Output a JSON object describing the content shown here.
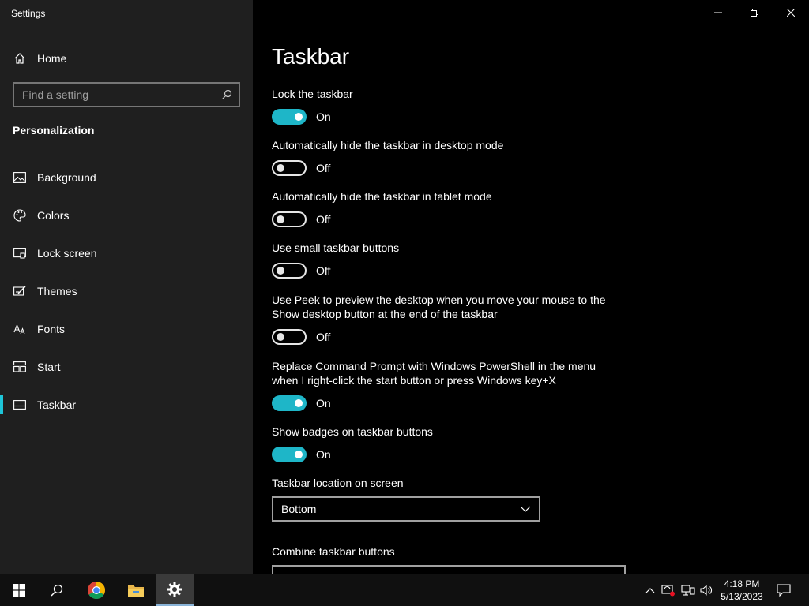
{
  "window": {
    "title": "Settings"
  },
  "sidebar": {
    "home_label": "Home",
    "search_placeholder": "Find a setting",
    "section_title": "Personalization",
    "items": [
      {
        "label": "Background",
        "icon": "picture-icon"
      },
      {
        "label": "Colors",
        "icon": "palette-icon"
      },
      {
        "label": "Lock screen",
        "icon": "lock-screen-icon"
      },
      {
        "label": "Themes",
        "icon": "themes-icon"
      },
      {
        "label": "Fonts",
        "icon": "fonts-icon"
      },
      {
        "label": "Start",
        "icon": "start-icon"
      },
      {
        "label": "Taskbar",
        "icon": "taskbar-icon",
        "active": true
      }
    ]
  },
  "main": {
    "title": "Taskbar",
    "settings": [
      {
        "label": "Lock the taskbar",
        "state": "On"
      },
      {
        "label": "Automatically hide the taskbar in desktop mode",
        "state": "Off"
      },
      {
        "label": "Automatically hide the taskbar in tablet mode",
        "state": "Off"
      },
      {
        "label": "Use small taskbar buttons",
        "state": "Off"
      },
      {
        "label": "Use Peek to preview the desktop when you move your mouse to the Show desktop button at the end of the taskbar",
        "state": "Off"
      },
      {
        "label": "Replace Command Prompt with Windows PowerShell in the menu when I right-click the start button or press Windows key+X",
        "state": "On"
      },
      {
        "label": "Show badges on taskbar buttons",
        "state": "On"
      }
    ],
    "location_label": "Taskbar location on screen",
    "location_value": "Bottom",
    "combine_label": "Combine taskbar buttons"
  },
  "taskbar": {
    "time": "4:18 PM",
    "date": "5/13/2023",
    "apps": [
      "start-icon",
      "search-icon",
      "chrome-icon",
      "file-explorer-icon",
      "settings-icon"
    ]
  },
  "colors": {
    "accent": "#1eb6c8",
    "sidebar_bg": "#1f1f1f",
    "main_bg": "#000000"
  }
}
